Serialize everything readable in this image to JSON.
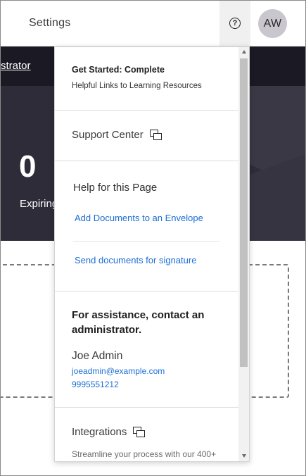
{
  "header": {
    "settings_label": "Settings",
    "help_icon": "question-circle-icon",
    "avatar_initials": "AW"
  },
  "strip": {
    "admin_link": "strator"
  },
  "hero": {
    "count": "0",
    "count_label": "Expiring"
  },
  "menu": {
    "get_started": {
      "title": "Get Started: Complete",
      "subtitle": "Helpful Links to Learning Resources"
    },
    "support_center": {
      "label": "Support Center",
      "icon": "external-link-icon"
    },
    "help_page": {
      "title": "Help for this Page",
      "links": [
        "Add Documents to an Envelope",
        "Send documents for signature"
      ]
    },
    "assistance": {
      "title": "For assistance, contact an administrator.",
      "admin_name": "Joe Admin",
      "admin_email": "joeadmin@example.com",
      "admin_phone": "9995551212"
    },
    "integrations": {
      "label": "Integrations",
      "icon": "external-link-icon",
      "description": "Streamline your process with our 400+"
    }
  },
  "colors": {
    "link_blue": "#1b6ed6",
    "dark_strip": "#1b1a24",
    "hero_bg": "#2e2c38"
  }
}
